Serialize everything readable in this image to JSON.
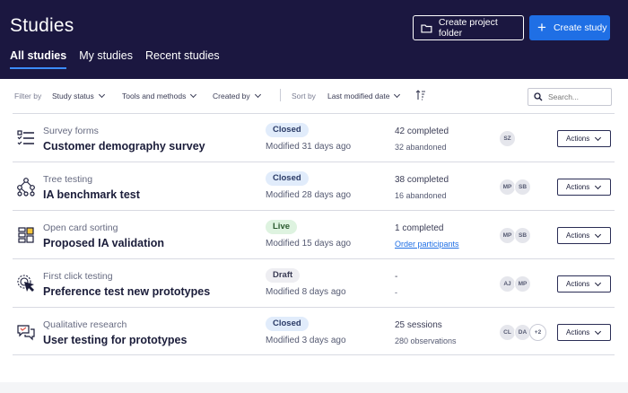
{
  "header": {
    "title": "Studies",
    "create_folder_label": "Create project folder",
    "create_study_label": "Create study",
    "tabs": [
      {
        "label": "All studies"
      },
      {
        "label": "My studies"
      },
      {
        "label": "Recent studies"
      }
    ]
  },
  "filters": {
    "filter_by_label": "Filter by",
    "study_status": "Study status",
    "tools_methods": "Tools and methods",
    "created_by": "Created by",
    "sort_by_label": "Sort by",
    "sort_value": "Last modified date",
    "search_placeholder": "Search..."
  },
  "studies": [
    {
      "type": "Survey forms",
      "name": "Customer demography survey",
      "status": "Closed",
      "modified": "Modified 31 days ago",
      "stat1": "42 completed",
      "stat2": "32 abandoned",
      "avatars": [
        "SZ"
      ],
      "actions": "Actions"
    },
    {
      "type": "Tree testing",
      "name": "IA benchmark test",
      "status": "Closed",
      "modified": "Modified 28 days ago",
      "stat1": "38 completed",
      "stat2": "16 abandoned",
      "avatars": [
        "MP",
        "SB"
      ],
      "actions": "Actions"
    },
    {
      "type": "Open card sorting",
      "name": "Proposed IA validation",
      "status": "Live",
      "modified": "Modified 15 days ago",
      "stat1": "1 completed",
      "stat2": "Order participants",
      "avatars": [
        "MP",
        "SB"
      ],
      "actions": "Actions"
    },
    {
      "type": "First click testing",
      "name": "Preference test new prototypes",
      "status": "Draft",
      "modified": "Modified 8 days ago",
      "stat1": "-",
      "stat2": "-",
      "avatars": [
        "AJ",
        "MP"
      ],
      "actions": "Actions"
    },
    {
      "type": "Qualitative research",
      "name": "User testing for prototypes",
      "status": "Closed",
      "modified": "Modified 3 days ago",
      "stat1": "25 sessions",
      "stat2": "280 observations",
      "avatars": [
        "CL",
        "DA",
        "+2"
      ],
      "actions": "Actions"
    }
  ],
  "colors": {
    "header_bg": "#1b1740",
    "primary": "#1f6fe5",
    "closed_badge": "#e1ecfb",
    "live_badge": "#def3e0",
    "draft_badge": "#eeeef2"
  },
  "icons": [
    "folder-icon",
    "plus-icon",
    "sort-icon",
    "search-icon",
    "survey-icon",
    "tree-icon",
    "card-sort-icon",
    "first-click-icon",
    "qualitative-icon",
    "chevron-down-icon"
  ]
}
